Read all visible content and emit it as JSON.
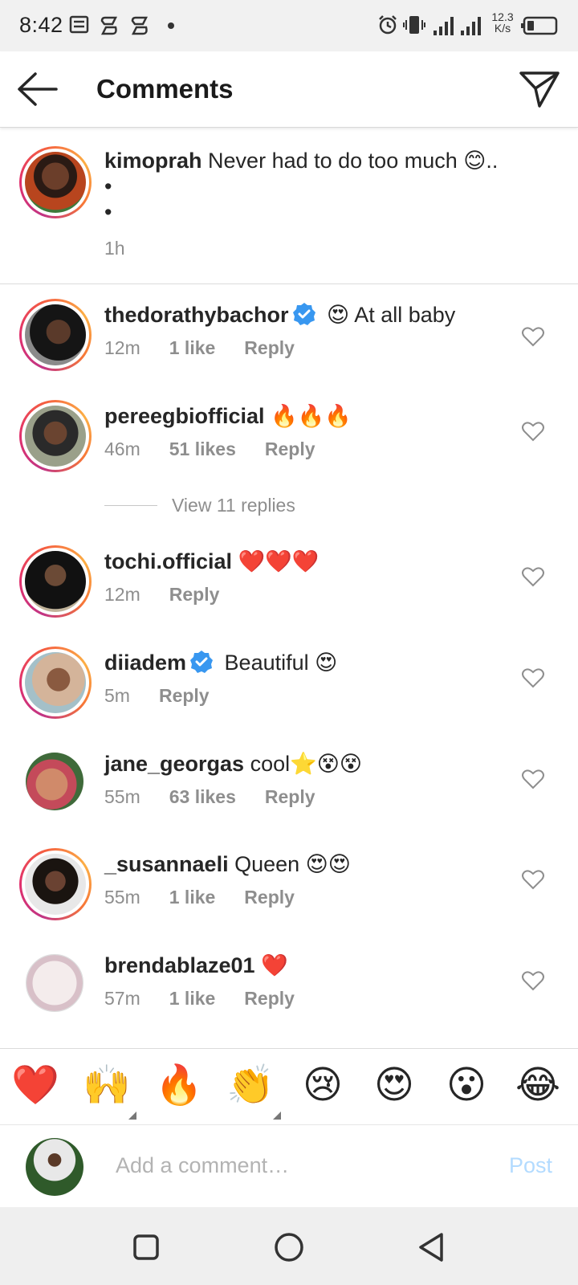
{
  "status_bar": {
    "time": "8:42",
    "net_speed_value": "12.3",
    "net_speed_unit": "K/s"
  },
  "header": {
    "title": "Comments"
  },
  "caption": {
    "username": "kimoprah",
    "text": "Never had to do too much 😊..",
    "line2": "•",
    "line3": "•",
    "time": "1h"
  },
  "comments": [
    {
      "username": "thedorathybachor",
      "verified": true,
      "text": "😍 At all baby",
      "time": "12m",
      "likes": "1 like",
      "reply": "Reply"
    },
    {
      "username": "pereegbiofficial",
      "verified": false,
      "text": "🔥🔥🔥",
      "time": "46m",
      "likes": "51 likes",
      "reply": "Reply"
    },
    {
      "username": "tochi.official",
      "verified": false,
      "text": "❤️❤️❤️",
      "time": "12m",
      "likes": "",
      "reply": "Reply"
    },
    {
      "username": "diiadem",
      "verified": true,
      "text": "Beautiful 😍",
      "time": "5m",
      "likes": "",
      "reply": "Reply"
    },
    {
      "username": "jane_georgas",
      "verified": false,
      "text": "cool⭐😵😵",
      "time": "55m",
      "likes": "63 likes",
      "reply": "Reply"
    },
    {
      "username": "_susannaeli",
      "verified": false,
      "text": "Queen 😍😍",
      "time": "55m",
      "likes": "1 like",
      "reply": "Reply"
    },
    {
      "username": "brendablaze01",
      "verified": false,
      "text": "❤️",
      "time": "57m",
      "likes": "1 like",
      "reply": "Reply"
    }
  ],
  "view_replies": "View 11 replies",
  "emoji_bar": [
    "❤️",
    "🙌",
    "🔥",
    "👏",
    "😢",
    "😍",
    "😮",
    "😂"
  ],
  "add_comment": {
    "placeholder": "Add a comment…",
    "post_label": "Post"
  },
  "colors": {
    "accent": "#3897f0",
    "verified": "#3897f0",
    "muted": "#8e8e8e",
    "post_disabled": "#b3dbff"
  }
}
